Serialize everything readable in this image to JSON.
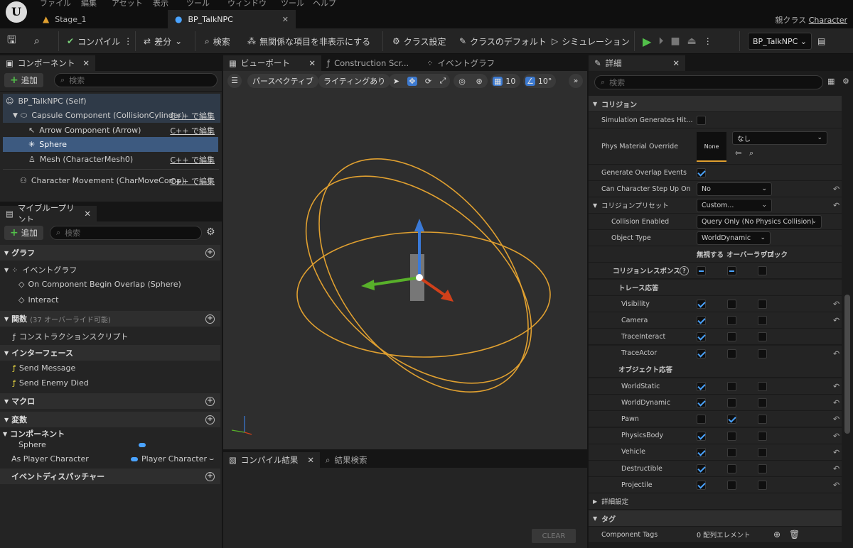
{
  "menu": [
    "ファイル",
    "編集",
    "アセット",
    "表示",
    "ツール",
    "ウィンドウ",
    "ツール",
    "ヘルプ"
  ],
  "tabs": [
    {
      "label": "Stage_1"
    },
    {
      "label": "BP_TalkNPC"
    }
  ],
  "parent_class": {
    "label": "親クラス",
    "value": "Character"
  },
  "toolbar": {
    "compile": "コンパイル",
    "diff": "差分",
    "search": "検索",
    "hide_unrelated": "無関係な項目を非表示にする",
    "class_settings": "クラス設定",
    "class_defaults": "クラスのデフォルト",
    "simulation": "シミュレーション",
    "debug_object": "BP_TalkNPC"
  },
  "components": {
    "tab": "コンポーネント",
    "add": "追加",
    "search_placeholder": "検索",
    "items": [
      {
        "label": "BP_TalkNPC (Self)",
        "cpp": ""
      },
      {
        "label": "Capsule Component (CollisionCylinder)",
        "cpp": "C++ で編集"
      },
      {
        "label": "Arrow Component (Arrow)",
        "cpp": "C++ で編集"
      },
      {
        "label": "Sphere",
        "cpp": ""
      },
      {
        "label": "Mesh (CharacterMesh0)",
        "cpp": "C++ で編集"
      },
      {
        "label": "Character Movement (CharMoveComp)",
        "cpp": "C++ で編集"
      }
    ]
  },
  "my_blueprint": {
    "tab": "マイブループリント",
    "add": "追加",
    "search_placeholder": "検索",
    "graph": "グラフ",
    "event_graph": "イベントグラフ",
    "events": [
      "On Component Begin Overlap (Sphere)",
      "Interact"
    ],
    "functions": "関数",
    "functions_count": "(37 オーバーライド可能)",
    "construction_script": "コンストラクションスクリプト",
    "interfaces": "インターフェース",
    "interface_items": [
      "Send Message",
      "Send Enemy Died"
    ],
    "macros": "マクロ",
    "variables": "変数",
    "components_cat": "コンポーネント",
    "vars": [
      {
        "name": "Sphere",
        "type": ""
      },
      {
        "name": "As Player Character",
        "type": "Player Character"
      }
    ],
    "dispatchers": "イベントディスパッチャー"
  },
  "viewport": {
    "tab1": "ビューポート",
    "tab2": "Construction Scr...",
    "tab3": "イベントグラフ",
    "perspective": "パースペクティブ",
    "lighting": "ライティングあり",
    "grid": "10",
    "angle": "10°"
  },
  "compile_results": {
    "tab1": "コンパイル結果",
    "tab2": "結果検索",
    "clear": "CLEAR"
  },
  "details": {
    "tab": "詳細",
    "search_placeholder": "検索",
    "collision": "コリジョン",
    "sim_gen_hit": "Simulation Generates Hit...",
    "phys_mat": "Phys Material Override",
    "phys_mat_thumb": "None",
    "phys_mat_value": "なし",
    "gen_overlap": "Generate Overlap Events",
    "step_up": "Can Character Step Up On",
    "step_up_value": "No",
    "preset": "コリジョンプリセット",
    "preset_value": "Custom...",
    "coll_enabled": "Collision Enabled",
    "coll_enabled_value": "Query Only (No Physics Collision)",
    "object_type": "Object Type",
    "object_type_value": "WorldDynamic",
    "col_ignore": "無視する",
    "col_overlap": "オーバーラップ",
    "col_block": "ブロック",
    "responses": "コリジョンレスポンス",
    "trace": "トレース応答",
    "trace_rows": [
      {
        "label": "Visibility",
        "state": [
          1,
          0,
          0
        ],
        "reset": true
      },
      {
        "label": "Camera",
        "state": [
          1,
          0,
          0
        ],
        "reset": true
      },
      {
        "label": "TraceInteract",
        "state": [
          1,
          0,
          0
        ],
        "reset": false
      },
      {
        "label": "TraceActor",
        "state": [
          1,
          0,
          0
        ],
        "reset": true
      }
    ],
    "object": "オブジェクト応答",
    "object_rows": [
      {
        "label": "WorldStatic",
        "state": [
          1,
          0,
          0
        ],
        "reset": true
      },
      {
        "label": "WorldDynamic",
        "state": [
          1,
          0,
          0
        ],
        "reset": true
      },
      {
        "label": "Pawn",
        "state": [
          0,
          1,
          0
        ],
        "reset": true
      },
      {
        "label": "PhysicsBody",
        "state": [
          1,
          0,
          0
        ],
        "reset": true
      },
      {
        "label": "Vehicle",
        "state": [
          1,
          0,
          0
        ],
        "reset": true
      },
      {
        "label": "Destructible",
        "state": [
          1,
          0,
          0
        ],
        "reset": true
      },
      {
        "label": "Projectile",
        "state": [
          1,
          0,
          0
        ],
        "reset": true
      }
    ],
    "advanced": "詳細設定",
    "tags": "タグ",
    "component_tags": "Component Tags",
    "component_tags_value": "0 配列エレメント"
  },
  "colors": {
    "accent": "#4aa3ff",
    "selected": "#3d5a80",
    "sphere": "#e0a030",
    "play": "#52c04a"
  }
}
